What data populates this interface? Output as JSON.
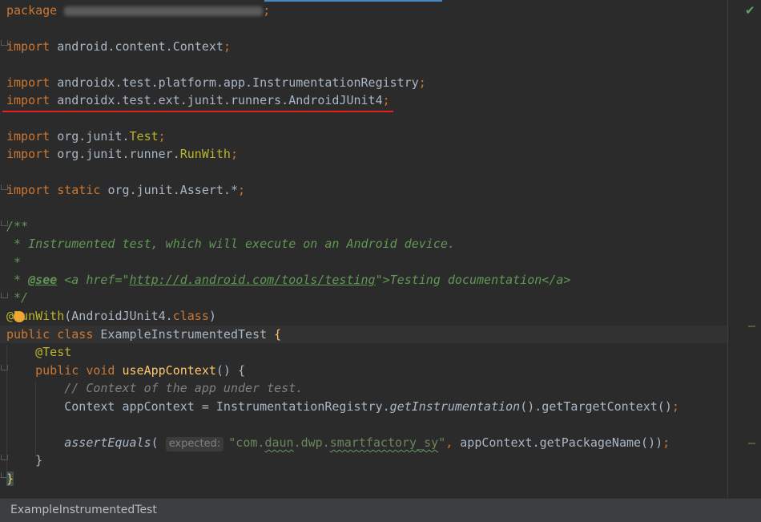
{
  "editor": {
    "package_kw": "package",
    "import_kw": "import",
    "static_kw": "static",
    "semicolon": ";",
    "imports": {
      "i1": "android.content.Context",
      "i2": "androidx.test.platform.app.InstrumentationRegistry",
      "i3": "androidx.test.ext.junit.runners.AndroidJUnit4",
      "i4_prefix": "org.junit.",
      "i4_class": "Test",
      "i5_prefix": "org.junit.runner.",
      "i5_class": "RunWith",
      "i6": "org.junit.Assert.*"
    },
    "javadoc": {
      "open": "/**",
      "line1": " * Instrumented test, which will execute on an Android device.",
      "star": " *",
      "see_prefix": " * ",
      "see_tag": "@see",
      "see_a_open": " <a href=\"",
      "see_url": "http://d.android.com/tools/testing",
      "see_a_close": "\">Testing documentation</a>",
      "close": " */"
    },
    "annotation": {
      "at": "@",
      "name": "RunWith",
      "args_open": "(AndroidJUnit4.",
      "class_kw": "class",
      "args_close": ")"
    },
    "class_decl": {
      "public_kw": "public",
      "class_kw": "class",
      "name": "ExampleInstrumentedTest",
      "brace": "{"
    },
    "test_annotation": "@Test",
    "method": {
      "public_kw": "public",
      "void_kw": "void",
      "name": "useAppContext",
      "params": "() {"
    },
    "comment": "// Context of the app under test.",
    "context_line": {
      "type": "Context appContext = InstrumentationRegistry.",
      "call": "getInstrumentation",
      "rest": "().getTargetContext()",
      "semi": ";"
    },
    "assert_line": {
      "call": "assertEquals",
      "paren": "(",
      "hint": "expected:",
      "str_a": "\"com.",
      "str_b": "daun",
      "str_c": ".dwp.",
      "str_d": "smartfactory_sy",
      "str_e": "\"",
      "comma": ",",
      "rest": " appContext.getPackageName())",
      "semi": ";"
    },
    "close_method": "}",
    "close_class": "}"
  },
  "status_bar": {
    "breadcrumb": "ExampleInstrumentedTest"
  },
  "colors": {
    "background": "#2b2b2b",
    "keyword": "#cc7832",
    "annotation": "#bbb529",
    "string": "#6a8759",
    "doc_comment": "#629755",
    "method": "#ffc66d",
    "error_underline": "#e8201d"
  },
  "icons": [
    "check-icon",
    "lightbulb-icon",
    "fold-icon"
  ]
}
